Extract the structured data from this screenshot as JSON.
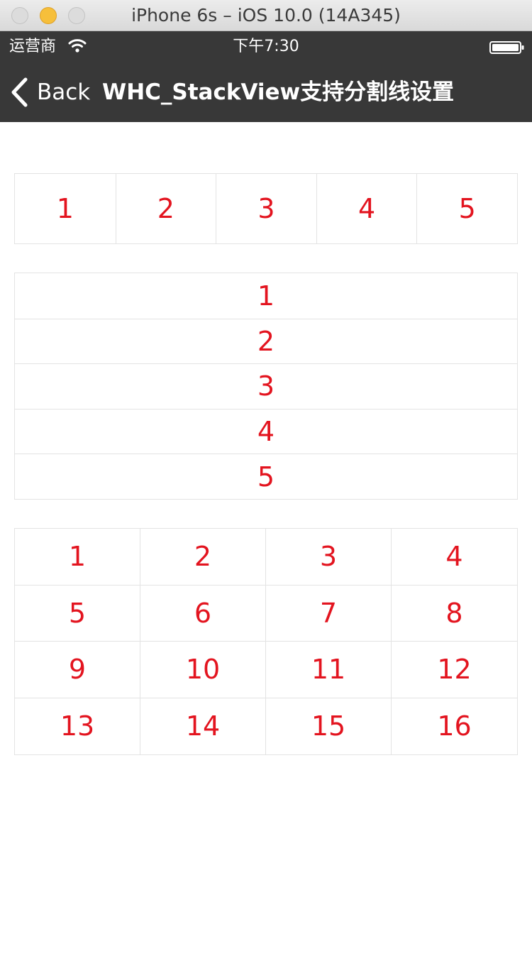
{
  "window": {
    "title": "iPhone 6s – iOS 10.0 (14A345)"
  },
  "status_bar": {
    "carrier": "运营商",
    "time": "下午7:30",
    "wifi_icon": "wifi-icon",
    "battery_icon": "battery-icon"
  },
  "nav_bar": {
    "back_label": "Back",
    "title": "WHC_StackView支持分割线设置",
    "back_icon": "chevron-left-icon"
  },
  "colors": {
    "number_text": "#e3141f",
    "separator": "#e3e3e3",
    "bar_background": "#383838"
  },
  "horizontal_stack": {
    "items": [
      "1",
      "2",
      "3",
      "4",
      "5"
    ]
  },
  "vertical_stack": {
    "items": [
      "1",
      "2",
      "3",
      "4",
      "5"
    ]
  },
  "grid_stack": {
    "items": [
      "1",
      "2",
      "3",
      "4",
      "5",
      "6",
      "7",
      "8",
      "9",
      "10",
      "11",
      "12",
      "13",
      "14",
      "15",
      "16"
    ]
  }
}
